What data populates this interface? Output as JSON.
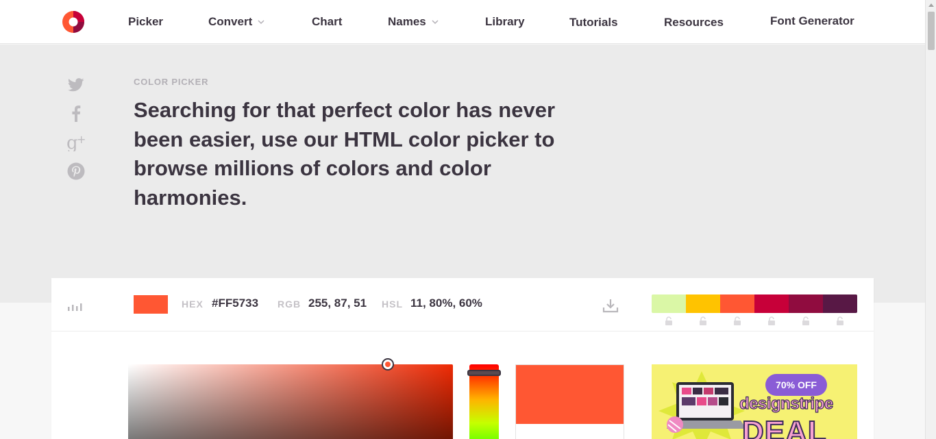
{
  "nav": {
    "logo": "colorcodes-logo",
    "items": [
      {
        "label": "Picker",
        "has_dropdown": false
      },
      {
        "label": "Convert",
        "has_dropdown": true
      },
      {
        "label": "Chart",
        "has_dropdown": false
      },
      {
        "label": "Names",
        "has_dropdown": true
      },
      {
        "label": "Library",
        "has_dropdown": false
      },
      {
        "label": "Tutorials",
        "has_dropdown": false
      },
      {
        "label": "Resources",
        "has_dropdown": false
      },
      {
        "label": "Font Generator",
        "has_dropdown": false
      }
    ]
  },
  "social": [
    "twitter-icon",
    "facebook-icon",
    "google-plus-icon",
    "pinterest-icon"
  ],
  "hero": {
    "eyebrow": "COLOR PICKER",
    "headline": "Searching for that perfect color has never been easier, use our HTML color picker to browse millions of colors and color harmonies."
  },
  "picker": {
    "current_color": "#FF5733",
    "hex_label": "HEX",
    "hex_value": "#FF5733",
    "rgb_label": "RGB",
    "rgb_value": "255, 87, 51",
    "hsl_label": "HSL",
    "hsl_value": "11, 80%, 60%",
    "palette": [
      "#DAF7A6",
      "#FFC300",
      "#FF5733",
      "#C70039",
      "#900C3F",
      "#581845"
    ]
  },
  "ad": {
    "badge": "70% OFF",
    "brand": "designstripe",
    "deal": "DEAL"
  }
}
